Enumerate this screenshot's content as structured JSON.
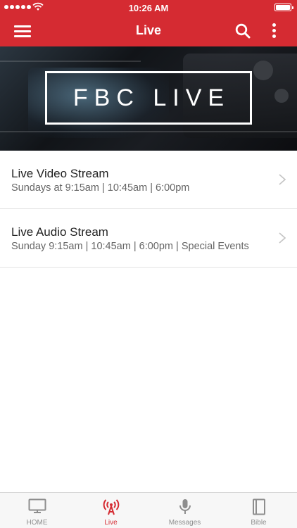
{
  "status_bar": {
    "time": "10:26 AM"
  },
  "nav": {
    "title": "Live"
  },
  "banner": {
    "text": "FBC LIVE"
  },
  "list": [
    {
      "title": "Live Video Stream",
      "subtitle": "Sundays at 9:15am | 10:45am | 6:00pm"
    },
    {
      "title": "Live Audio Stream",
      "subtitle": "Sunday 9:15am | 10:45am | 6:00pm | Special Events"
    }
  ],
  "tabs": [
    {
      "label": "HOME",
      "icon": "monitor-icon"
    },
    {
      "label": "Live",
      "icon": "broadcast-icon"
    },
    {
      "label": "Messages",
      "icon": "microphone-icon"
    },
    {
      "label": "Bible",
      "icon": "book-icon"
    }
  ],
  "colors": {
    "accent": "#d52b32",
    "tab_inactive": "#8e8e8e",
    "background": "#ffffff"
  }
}
